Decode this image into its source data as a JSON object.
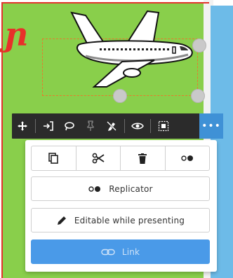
{
  "canvas": {
    "colors": {
      "green": "#89cf4b",
      "blue": "#6dbbe8",
      "red": "#e2342c",
      "accent": "#3f91d6"
    },
    "decor_letter": "ɲ"
  },
  "toolbar": {
    "buttons": [
      {
        "icon": "move-icon"
      },
      {
        "icon": "enter-icon"
      },
      {
        "icon": "lasso-icon"
      },
      {
        "icon": "pin-icon",
        "disabled": true
      },
      {
        "icon": "hide-pen-icon"
      },
      {
        "icon": "eye-icon"
      },
      {
        "icon": "frame-icon"
      }
    ],
    "more_label": "•••"
  },
  "menu": {
    "icon_row": [
      "copy-icon",
      "scissors-icon",
      "trash-icon",
      "record-icon"
    ],
    "replicator_label": "Replicator",
    "editable_label": "Editable while presenting",
    "link_label": "Link"
  }
}
